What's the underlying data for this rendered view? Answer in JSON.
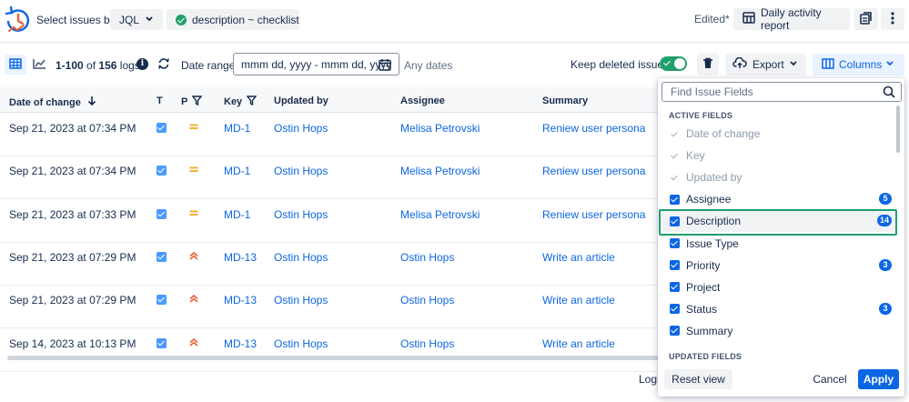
{
  "header": {
    "select_label": "Select issues by:",
    "jql_select": "JQL",
    "jql_query": "description ~ checklist",
    "edited": "Edited*",
    "daily_report": "Daily activity report"
  },
  "toolbar": {
    "range": "1-100",
    "of": "of",
    "total": "156",
    "logs": "logs",
    "date_range_label": "Date range:",
    "date_placeholder": "mmm dd, yyyy - mmm dd, yyyy",
    "any_dates": "Any dates",
    "keep_deleted": "Keep deleted issues",
    "export": "Export",
    "columns": "Columns"
  },
  "table": {
    "headers": {
      "date": "Date of change",
      "t": "T",
      "p": "P",
      "key": "Key",
      "updated_by": "Updated by",
      "assignee": "Assignee",
      "summary": "Summary"
    },
    "rows": [
      {
        "date": "Sep 21, 2023 at 07:34 PM",
        "priority": "medium",
        "key": "MD-1",
        "updated_by": "Ostin Hops",
        "assignee": "Melisa Petrovski",
        "summary": "Reniew user persona"
      },
      {
        "date": "Sep 21, 2023 at 07:34 PM",
        "priority": "medium",
        "key": "MD-1",
        "updated_by": "Ostin Hops",
        "assignee": "Melisa Petrovski",
        "summary": "Reniew user persona"
      },
      {
        "date": "Sep 21, 2023 at 07:33 PM",
        "priority": "medium",
        "key": "MD-1",
        "updated_by": "Ostin Hops",
        "assignee": "Melisa Petrovski",
        "summary": "Reniew user persona"
      },
      {
        "date": "Sep 21, 2023 at 07:29 PM",
        "priority": "high",
        "key": "MD-13",
        "updated_by": "Ostin Hops",
        "assignee": "Ostin Hops",
        "summary": "Write an article"
      },
      {
        "date": "Sep 21, 2023 at 07:29 PM",
        "priority": "high",
        "key": "MD-13",
        "updated_by": "Ostin Hops",
        "assignee": "Ostin Hops",
        "summary": "Write an article"
      },
      {
        "date": "Sep 14, 2023 at 10:13 PM",
        "priority": "high",
        "key": "MD-13",
        "updated_by": "Ostin Hops",
        "assignee": "Ostin Hops",
        "summary": "Write an article"
      }
    ],
    "footer_text": "Logs"
  },
  "columns_panel": {
    "search_placeholder": "Find Issue Fields",
    "active_title": "ACTIVE FIELDS",
    "updated_title": "UPDATED FIELDS",
    "fields": [
      {
        "label": "Date of change",
        "disabled": true,
        "badge": ""
      },
      {
        "label": "Key",
        "disabled": true,
        "badge": ""
      },
      {
        "label": "Updated by",
        "disabled": true,
        "badge": ""
      },
      {
        "label": "Assignee",
        "disabled": false,
        "badge": "5"
      },
      {
        "label": "Description",
        "disabled": false,
        "badge": "14"
      },
      {
        "label": "Issue Type",
        "disabled": false,
        "badge": ""
      },
      {
        "label": "Priority",
        "disabled": false,
        "badge": "3"
      },
      {
        "label": "Project",
        "disabled": false,
        "badge": ""
      },
      {
        "label": "Status",
        "disabled": false,
        "badge": "3"
      },
      {
        "label": "Summary",
        "disabled": false,
        "badge": ""
      }
    ],
    "reset": "Reset view",
    "cancel": "Cancel",
    "apply": "Apply"
  },
  "colors": {
    "accent": "#0c66e4",
    "success": "#22a06b",
    "highlight_frame": "#1f9e6e",
    "priority_medium": "#f5a623",
    "priority_high": "#e5623b"
  },
  "icons": {
    "logo": "clock-history-icon",
    "grid_view": "table-grid-icon",
    "chart_view": "line-chart-icon",
    "calendar": "calendar-icon",
    "trash": "trash-icon",
    "export": "cloud-upload-icon",
    "columns": "columns-icon",
    "search": "search-icon",
    "copy": "copy-icon",
    "more": "more-vertical-icon"
  }
}
